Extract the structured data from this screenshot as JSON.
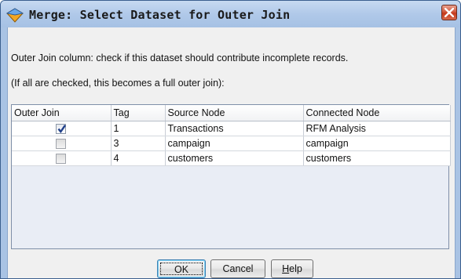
{
  "window": {
    "title": "Merge: Select Dataset for Outer Join",
    "icon": "diamond-node-icon",
    "close_icon": "close-x-icon"
  },
  "description": {
    "line1": "Outer Join column: check if this dataset should contribute incomplete records.",
    "line2": "(If all are checked, this becomes a full outer join):"
  },
  "table": {
    "columns": [
      "Outer Join",
      "Tag",
      "Source Node",
      "Connected Node"
    ],
    "rows": [
      {
        "outer_join": true,
        "tag": "1",
        "source": "Transactions",
        "connected": "RFM Analysis"
      },
      {
        "outer_join": false,
        "tag": "3",
        "source": "campaign",
        "connected": "campaign"
      },
      {
        "outer_join": false,
        "tag": "4",
        "source": "customers",
        "connected": "customers"
      }
    ]
  },
  "buttons": {
    "ok": "OK",
    "cancel": "Cancel",
    "help_prefix": "",
    "help_mnemonic": "H",
    "help_rest": "elp"
  },
  "colors": {
    "title_bar": "#b0c9e9",
    "close_button": "#c4391b",
    "check_mark": "#1f3f8a"
  }
}
